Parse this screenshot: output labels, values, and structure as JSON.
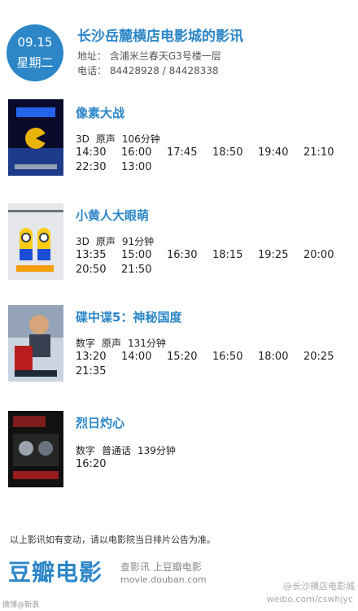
{
  "header": {
    "date": "09.15",
    "weekday": "星期二",
    "cinema_name": "长沙岳麓横店电影城的影讯",
    "address": "地址： 含浦米兰春天G3号楼一层",
    "phone": "电话： 84428928 / 84428338"
  },
  "movies": [
    {
      "title": "像素大战",
      "format": "3D",
      "audio": "原声",
      "duration": "106分钟",
      "times": [
        "14:30",
        "16:00",
        "17:45",
        "18:50",
        "19:40",
        "21:10",
        "22:30",
        "13:00"
      ],
      "poster_colors": [
        "#0a0a2a",
        "#1e3a8a",
        "#eab308"
      ]
    },
    {
      "title": "小黄人大眼萌",
      "format": "3D",
      "audio": "原声",
      "duration": "91分钟",
      "times": [
        "13:35",
        "15:00",
        "16:30",
        "18:15",
        "19:25",
        "20:00",
        "20:50",
        "21:50"
      ],
      "poster_colors": [
        "#e5e7eb",
        "#facc15",
        "#1d4ed8"
      ]
    },
    {
      "title": "碟中谍5：神秘国度",
      "format": "数字",
      "audio": "原声",
      "duration": "131分钟",
      "times": [
        "13:20",
        "14:00",
        "15:20",
        "16:50",
        "18:00",
        "20:25",
        "21:35"
      ],
      "poster_colors": [
        "#cbd5e1",
        "#b91c1c",
        "#374151"
      ]
    },
    {
      "title": "烈日灼心",
      "format": "数字",
      "audio": "普通话",
      "duration": "139分钟",
      "times": [
        "16:20"
      ],
      "poster_colors": [
        "#111111",
        "#7f1d1d",
        "#9ca3af"
      ]
    }
  ],
  "footer": {
    "notice": "以上影讯如有变动，请以电影院当日排片公告为准。",
    "logo": "豆瓣电影",
    "slogan": "查影讯  上豆瓣电影",
    "url": "movie.douban.com",
    "watermark_left": "微博@新浪",
    "watermark_right_1": "@长沙横店电影城",
    "watermark_right_2": "weibo.com/cswhjyc"
  }
}
